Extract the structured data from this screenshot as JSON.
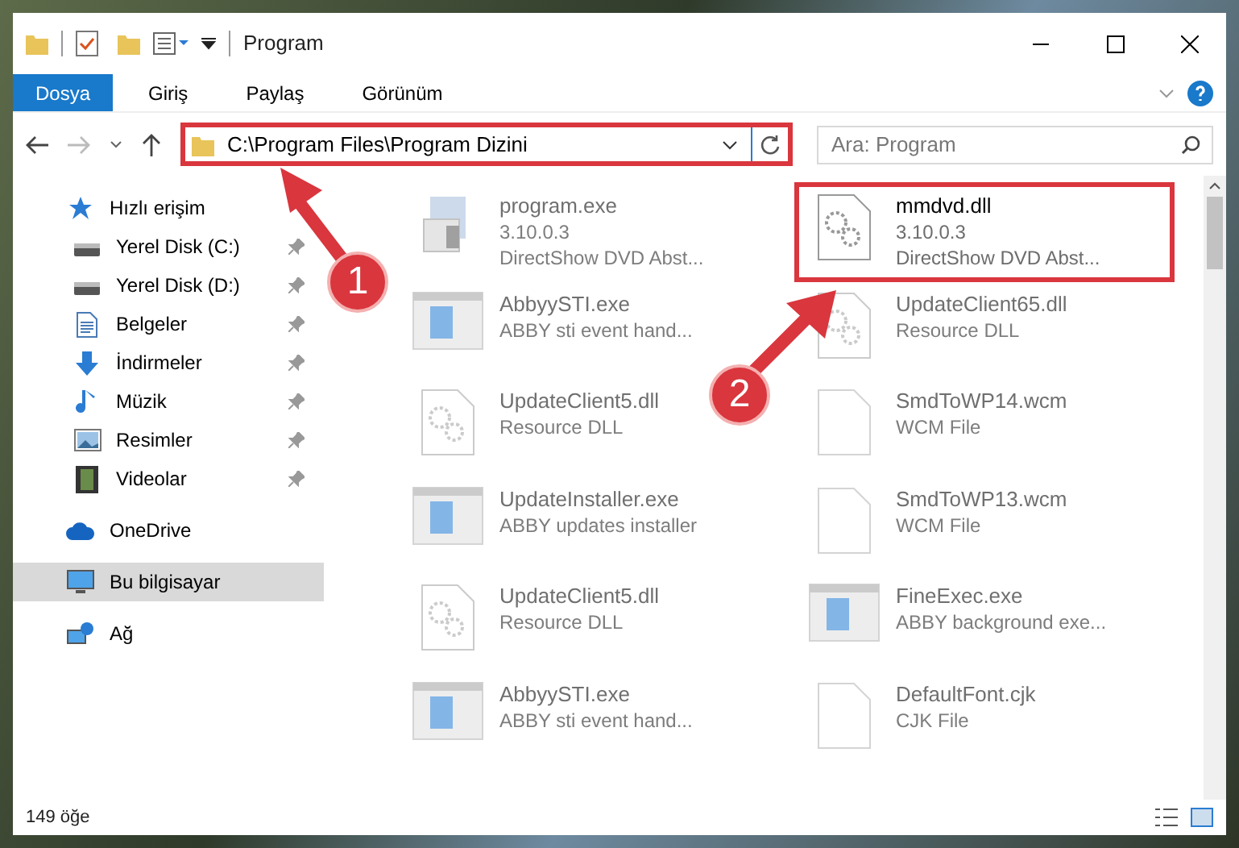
{
  "window": {
    "title": "Program"
  },
  "ribbon_tabs": [
    {
      "label": "Dosya",
      "selected": true
    },
    {
      "label": "Giriş",
      "selected": false
    },
    {
      "label": "Paylaş",
      "selected": false
    },
    {
      "label": "Görünüm",
      "selected": false
    }
  ],
  "address_bar": {
    "path": "C:\\Program Files\\Program Dizini",
    "highlighted": true
  },
  "search": {
    "placeholder": "Ara: Program"
  },
  "sidebar": {
    "items": [
      {
        "label": "Hızlı erişim",
        "kind": "star",
        "pinned": false,
        "selected": false,
        "children": [
          {
            "label": "Yerel Disk (C:)",
            "kind": "drive",
            "pinned": true,
            "selected": false
          },
          {
            "label": "Yerel Disk (D:)",
            "kind": "drive",
            "pinned": true,
            "selected": false
          },
          {
            "label": "Belgeler",
            "kind": "docs",
            "pinned": true,
            "selected": false
          },
          {
            "label": "İndirmeler",
            "kind": "download",
            "pinned": true,
            "selected": false
          },
          {
            "label": "Müzik",
            "kind": "music",
            "pinned": true,
            "selected": false
          },
          {
            "label": "Resimler",
            "kind": "pictures",
            "pinned": true,
            "selected": false
          },
          {
            "label": "Videolar",
            "kind": "video",
            "pinned": true,
            "selected": false
          }
        ]
      },
      {
        "label": "OneDrive",
        "kind": "cloud",
        "pinned": false,
        "selected": false
      },
      {
        "label": "Bu bilgisayar",
        "kind": "pc",
        "pinned": false,
        "selected": true
      },
      {
        "label": "Ağ",
        "kind": "network",
        "pinned": false,
        "selected": false
      }
    ]
  },
  "files": [
    {
      "name": "program.exe",
      "lines": [
        "3.10.0.3",
        "DirectShow DVD Abst..."
      ],
      "kind": "setup",
      "highlighted": false,
      "faded": true
    },
    {
      "name": "mmdvd.dll",
      "lines": [
        "3.10.0.3",
        "DirectShow DVD Abst..."
      ],
      "kind": "dll",
      "highlighted": true,
      "faded": false
    },
    {
      "name": "AbbyySTI.exe",
      "lines": [
        "ABBY sti event hand..."
      ],
      "kind": "app",
      "highlighted": false,
      "faded": true
    },
    {
      "name": "UpdateClient65.dll",
      "lines": [
        "Resource DLL"
      ],
      "kind": "dll",
      "highlighted": false,
      "faded": true
    },
    {
      "name": "UpdateClient5.dll",
      "lines": [
        "Resource DLL"
      ],
      "kind": "dll",
      "highlighted": false,
      "faded": true
    },
    {
      "name": "SmdToWP14.wcm",
      "lines": [
        "WCM File"
      ],
      "kind": "blank",
      "highlighted": false,
      "faded": true
    },
    {
      "name": "UpdateInstaller.exe",
      "lines": [
        "ABBY updates installer"
      ],
      "kind": "app",
      "highlighted": false,
      "faded": true
    },
    {
      "name": "SmdToWP13.wcm",
      "lines": [
        "WCM File"
      ],
      "kind": "blank",
      "highlighted": false,
      "faded": true
    },
    {
      "name": "UpdateClient5.dll",
      "lines": [
        "Resource DLL"
      ],
      "kind": "dll",
      "highlighted": false,
      "faded": true
    },
    {
      "name": "FineExec.exe",
      "lines": [
        "ABBY background exe..."
      ],
      "kind": "app",
      "highlighted": false,
      "faded": true
    },
    {
      "name": "AbbyySTI.exe",
      "lines": [
        "ABBY sti event hand..."
      ],
      "kind": "app",
      "highlighted": false,
      "faded": true
    },
    {
      "name": "DefaultFont.cjk",
      "lines": [
        "CJK File"
      ],
      "kind": "blank",
      "highlighted": false,
      "faded": true
    }
  ],
  "status_bar": {
    "count": "149 öğe"
  },
  "callouts": [
    "1",
    "2"
  ]
}
